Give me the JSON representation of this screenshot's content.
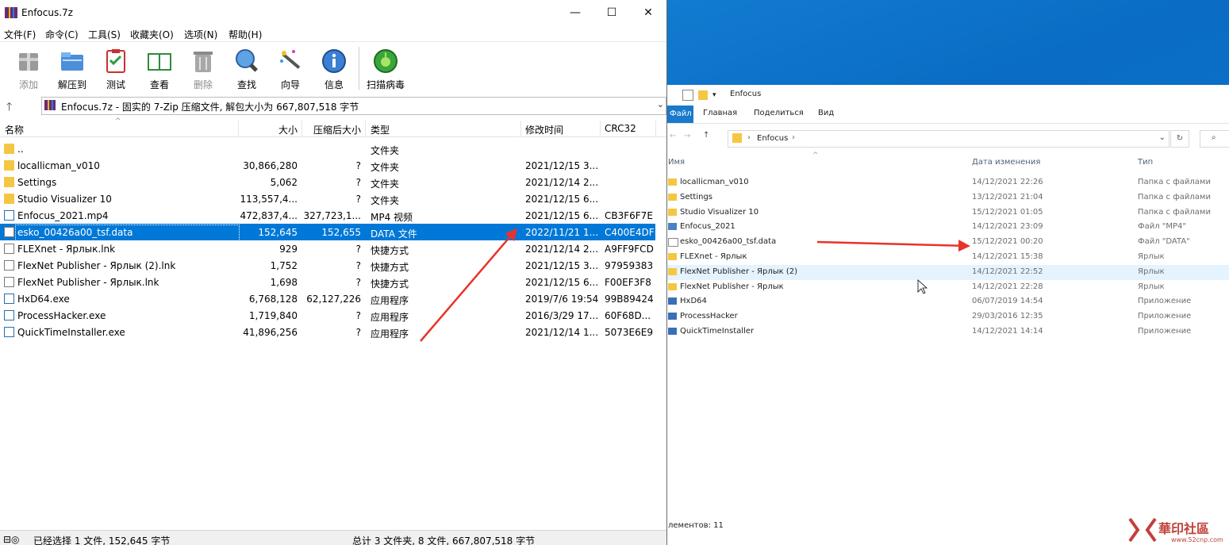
{
  "zip": {
    "title": "Enfocus.7z",
    "menu": [
      "文件(F)",
      "命令(C)",
      "工具(S)",
      "收藏夹(O)",
      "选项(N)",
      "帮助(H)"
    ],
    "toolbar": [
      {
        "label": "添加",
        "icon": "add-archive-icon",
        "enabled": false
      },
      {
        "label": "解压到",
        "icon": "extract-icon",
        "enabled": true
      },
      {
        "label": "测试",
        "icon": "test-icon",
        "enabled": true
      },
      {
        "label": "查看",
        "icon": "view-book-icon",
        "enabled": true
      },
      {
        "label": "删除",
        "icon": "delete-trash-icon",
        "enabled": false
      },
      {
        "label": "查找",
        "icon": "find-magnifier-icon",
        "enabled": true
      },
      {
        "label": "向导",
        "icon": "wizard-wand-icon",
        "enabled": true
      },
      {
        "label": "信息",
        "icon": "info-icon",
        "enabled": true
      },
      {
        "label": "扫描病毒",
        "icon": "scan-virus-icon",
        "enabled": true
      }
    ],
    "path": "Enfocus.7z - 固实的 7-Zip 压缩文件, 解包大小为 667,807,518 字节",
    "columns": {
      "name": "名称",
      "size": "大小",
      "packed": "压缩后大小",
      "type": "类型",
      "modified": "修改时间",
      "crc": "CRC32"
    },
    "rows": [
      {
        "name": "..",
        "size": "",
        "packed": "",
        "type": "文件夹",
        "modified": "",
        "crc": "",
        "icon": "folder"
      },
      {
        "name": "locallicman_v010",
        "size": "30,866,280",
        "packed": "?",
        "type": "文件夹",
        "modified": "2021/12/15 3...",
        "crc": "",
        "icon": "folder"
      },
      {
        "name": "Settings",
        "size": "5,062",
        "packed": "?",
        "type": "文件夹",
        "modified": "2021/12/14 2...",
        "crc": "",
        "icon": "folder"
      },
      {
        "name": "Studio Visualizer 10",
        "size": "113,557,4...",
        "packed": "?",
        "type": "文件夹",
        "modified": "2021/12/15 6...",
        "crc": "",
        "icon": "folder"
      },
      {
        "name": "Enfocus_2021.mp4",
        "size": "472,837,4...",
        "packed": "327,723,1...",
        "type": "MP4 视频",
        "modified": "2021/12/15 6...",
        "crc": "CB3F6F7E",
        "icon": "video"
      },
      {
        "name": "esko_00426a00_tsf.data",
        "size": "152,645",
        "packed": "152,655",
        "type": "DATA 文件",
        "modified": "2022/11/21 1...",
        "crc": "C400E4DF",
        "icon": "file",
        "selected": true
      },
      {
        "name": "FLEXnet - Ярлык.lnk",
        "size": "929",
        "packed": "?",
        "type": "快捷方式",
        "modified": "2021/12/14 2...",
        "crc": "A9FF9FCD",
        "icon": "file"
      },
      {
        "name": "FlexNet Publisher - Ярлык (2).lnk",
        "size": "1,752",
        "packed": "?",
        "type": "快捷方式",
        "modified": "2021/12/15 3...",
        "crc": "97959383",
        "icon": "file"
      },
      {
        "name": "FlexNet Publisher - Ярлык.lnk",
        "size": "1,698",
        "packed": "?",
        "type": "快捷方式",
        "modified": "2021/12/15 6...",
        "crc": "F00EF3F8",
        "icon": "file"
      },
      {
        "name": "HxD64.exe",
        "size": "6,768,128",
        "packed": "62,127,226",
        "type": "应用程序",
        "modified": "2019/7/6 19:54",
        "crc": "99B89424",
        "icon": "exe"
      },
      {
        "name": "ProcessHacker.exe",
        "size": "1,719,840",
        "packed": "?",
        "type": "应用程序",
        "modified": "2016/3/29 17...",
        "crc": "60F68D...",
        "icon": "exe"
      },
      {
        "name": "QuickTimeInstaller.exe",
        "size": "41,896,256",
        "packed": "?",
        "type": "应用程序",
        "modified": "2021/12/14 1...",
        "crc": "5073E6E9",
        "icon": "exe"
      }
    ],
    "status_left": "已经选择 1 文件, 152,645 字节",
    "status_right": "总计 3 文件夹, 8 文件, 667,807,518 字节"
  },
  "explorer": {
    "title": "Enfocus",
    "ribbon_tabs": [
      "Файл",
      "Главная",
      "Поделиться",
      "Вид"
    ],
    "address": "Enfocus",
    "columns": {
      "name": "Имя",
      "date": "Дата изменения",
      "type": "Тип"
    },
    "rows": [
      {
        "name": "locallicman_v010",
        "date": "14/12/2021 22:26",
        "type": "Папка с файлами",
        "icon": "folder"
      },
      {
        "name": "Settings",
        "date": "13/12/2021 21:04",
        "type": "Папка с файлами",
        "icon": "folder"
      },
      {
        "name": "Studio Visualizer 10",
        "date": "15/12/2021 01:05",
        "type": "Папка с файлами",
        "icon": "folder"
      },
      {
        "name": "Enfocus_2021",
        "date": "14/12/2021 23:09",
        "type": "Файл \"MP4\"",
        "icon": "video"
      },
      {
        "name": "esko_00426a00_tsf.data",
        "date": "15/12/2021 00:20",
        "type": "Файл \"DATA\"",
        "icon": "file"
      },
      {
        "name": "FLEXnet - Ярлык",
        "date": "14/12/2021 15:38",
        "type": "Ярлык",
        "icon": "folder"
      },
      {
        "name": "FlexNet Publisher - Ярлык (2)",
        "date": "14/12/2021 22:52",
        "type": "Ярлык",
        "icon": "folder",
        "hover": true
      },
      {
        "name": "FlexNet Publisher - Ярлык",
        "date": "14/12/2021 22:28",
        "type": "Ярлык",
        "icon": "folder"
      },
      {
        "name": "HxD64",
        "date": "06/07/2019 14:54",
        "type": "Приложение",
        "icon": "exe"
      },
      {
        "name": "ProcessHacker",
        "date": "29/03/2016 12:35",
        "type": "Приложение",
        "icon": "exe"
      },
      {
        "name": "QuickTimeInstaller",
        "date": "14/12/2021 14:14",
        "type": "Приложение",
        "icon": "exe"
      }
    ],
    "status": "лементов: 11"
  },
  "watermark": {
    "text": "華印社區",
    "url": "www.52cnp.com"
  },
  "colors": {
    "selection": "#0078d7",
    "arrow": "#e8332b",
    "desktop": "#0078d7"
  }
}
